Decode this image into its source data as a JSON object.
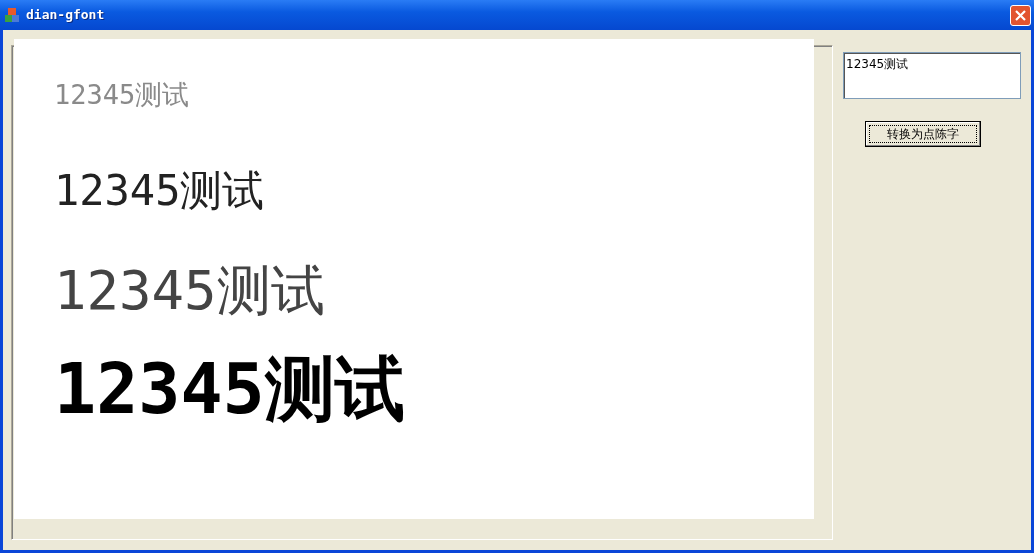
{
  "window": {
    "title": "dian-gfont"
  },
  "samples": [
    {
      "text": "12345测试"
    },
    {
      "text": "12345测试"
    },
    {
      "text": "12345测试"
    },
    {
      "text": "12345测试"
    }
  ],
  "input": {
    "value": "12345测试"
  },
  "button": {
    "label": "转换为点陈字"
  }
}
